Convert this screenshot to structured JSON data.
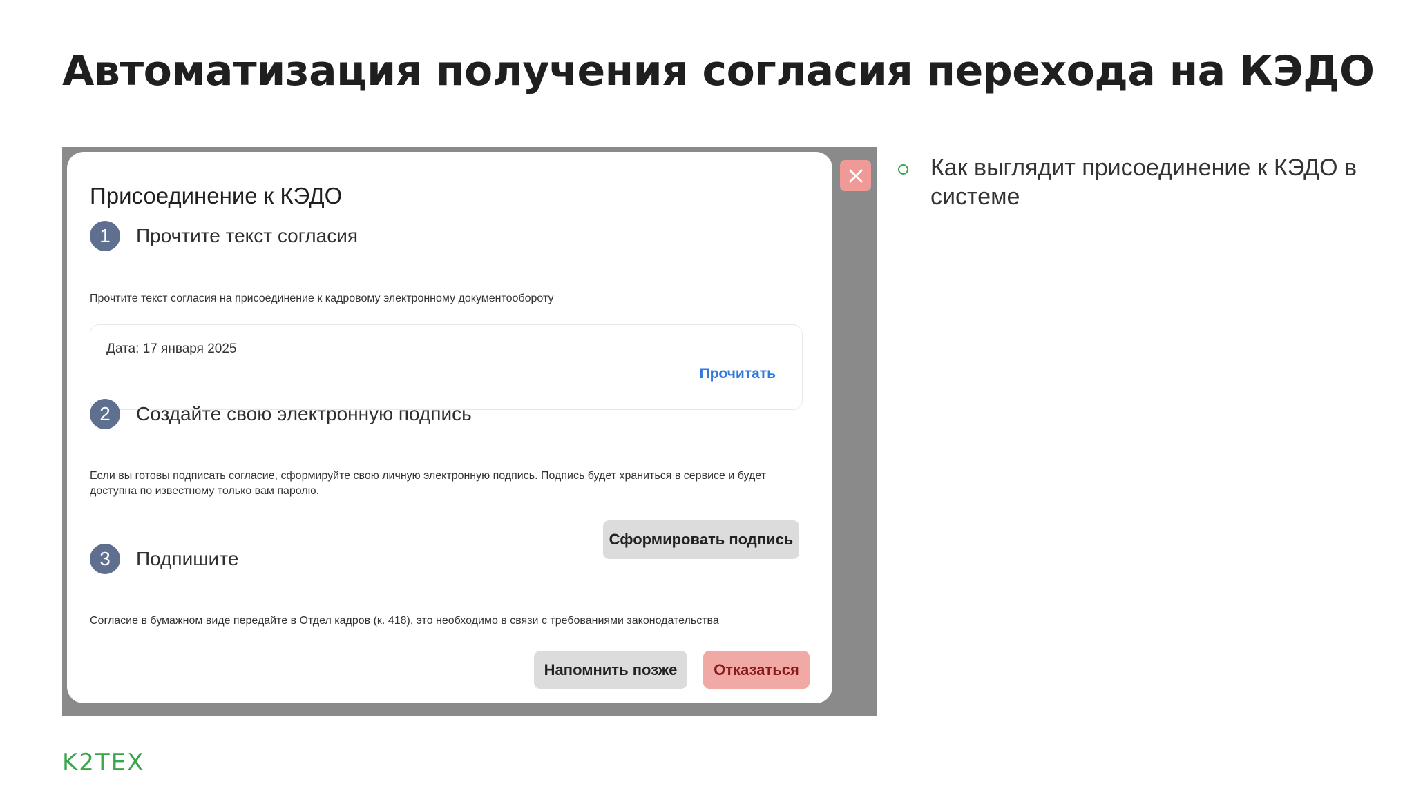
{
  "slide": {
    "title": "Автоматизация получения согласия перехода на КЭДО",
    "bullet": "Как выглядит присоединение к КЭДО в системе",
    "logo": "K2TEX"
  },
  "modal": {
    "title": "Присоединение к КЭДО",
    "close_icon": "close-icon",
    "steps": [
      {
        "number": "1",
        "title": "Прочтите текст согласия",
        "description": "Прочтите текст согласия на присоединение к кадровому электронному документообороту"
      },
      {
        "number": "2",
        "title": "Создайте свою электронную подпись",
        "description": "Если вы готовы подписать согласие, сформируйте свою личную электронную подпись. Подпись будет храниться в сервисе и будет доступна по известному только вам паролю."
      },
      {
        "number": "3",
        "title": "Подпишите",
        "description": "Согласие в бумажном виде передайте в Отдел кадров (к. 418), это необходимо в связи с требованиями законодательства"
      }
    ],
    "document": {
      "date": "Дата: 17 января 2025",
      "read_link": "Прочитать"
    },
    "buttons": {
      "create_signature": "Сформировать подпись",
      "remind_later": "Напомнить позже",
      "decline": "Отказаться"
    }
  },
  "colors": {
    "accent_green": "#3aa64c",
    "step_badge": "#5f6f8f",
    "link_blue": "#2f7be0",
    "decline_bg": "#f1a9a6",
    "close_bg": "#ef9a96",
    "overlay_gray": "#8a8a8a"
  }
}
